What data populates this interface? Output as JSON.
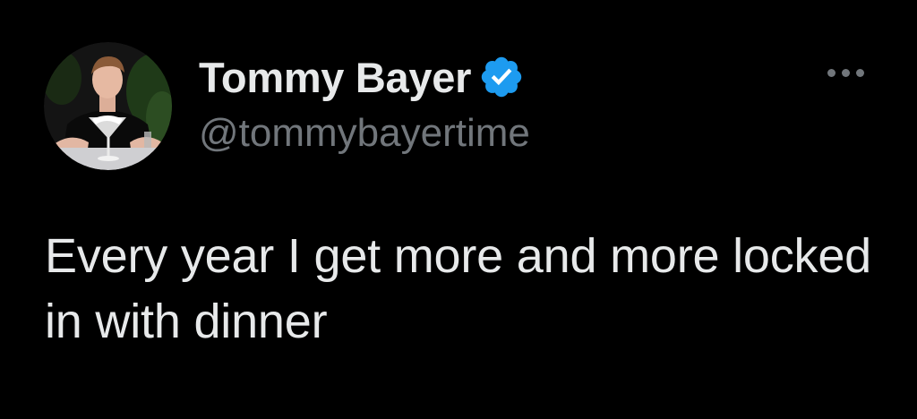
{
  "author": {
    "display_name": "Tommy Bayer",
    "handle": "@tommybayertime",
    "verified": true,
    "avatar_icon": "profile-photo"
  },
  "tweet": {
    "text": "Every year I get more and more locked in with dinner"
  },
  "menu": {
    "icon": "more-options-icon"
  },
  "colors": {
    "background": "#000000",
    "primary_text": "#e7e9ea",
    "secondary_text": "#71767b",
    "verified_badge": "#1d9bf0"
  }
}
